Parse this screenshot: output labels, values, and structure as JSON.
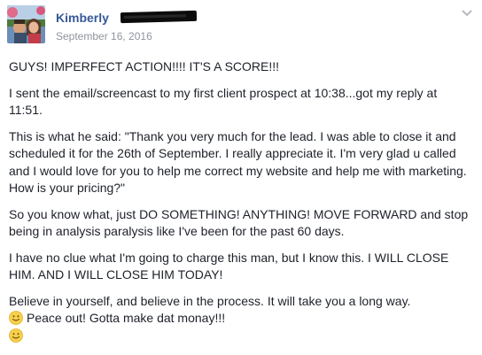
{
  "post": {
    "author_name": "Kimberly",
    "date": "September 16, 2016",
    "paragraphs": [
      "GUYS! IMPERFECT ACTION!!!! IT'S A SCORE!!!",
      "I sent the email/screencast to my first client prospect at 10:38...got my reply at 11:51.",
      "This is what he said: \"Thank you very much for the lead. I was able to close it and scheduled it for the 26th of September. I really appreciate it. I'm very glad u called and I would love for you to help me correct my website and help me with marketing. How is your pricing?\"",
      "So you know what, just DO SOMETHING! ANYTHING! MOVE FORWARD and stop being in analysis paralysis like I've been for the past 60 days.",
      "I have no clue what I'm going to charge this man, but I know this. I WILL CLOSE HIM. AND I WILL CLOSE HIM TODAY!",
      "Believe in yourself, and believe in the process. It will take you a long way."
    ],
    "closing_line": "Peace out! Gotta make dat monay!!!",
    "icons": {
      "avatar": "profile-photo",
      "menu": "chevron-down-icon",
      "emoji": "smiley-face-icon"
    },
    "colors": {
      "author_link": "#365899",
      "meta_text": "#90949c",
      "body_text": "#1d2129",
      "emoji_fill": "#f7d04b"
    }
  }
}
